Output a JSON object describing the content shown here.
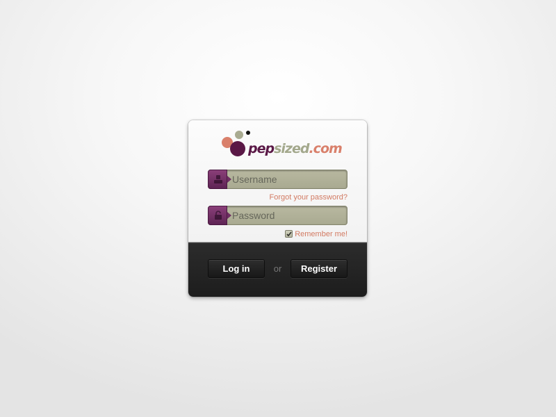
{
  "logo": {
    "text_part1": "pep",
    "text_part2": "sized",
    "text_part3": ".com",
    "colors": {
      "purple": "#5a1846",
      "sage": "#a3a88c",
      "salmon": "#d9806b"
    }
  },
  "form": {
    "username_placeholder": "Username",
    "username_value": "",
    "password_placeholder": "Password",
    "password_value": "",
    "forgot_label": "Forgot your password?",
    "remember_label": "Remember me!",
    "remember_checked": true
  },
  "actions": {
    "login_label": "Log in",
    "or_label": "or",
    "register_label": "Register"
  },
  "icons": {
    "username": "user-icon",
    "password": "lock-icon",
    "checkbox": "checkmark-icon"
  }
}
